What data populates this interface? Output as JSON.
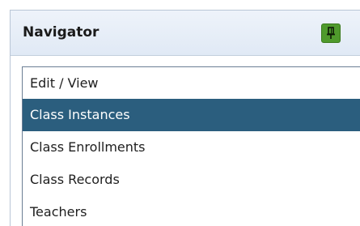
{
  "navigator": {
    "title": "Navigator",
    "pin_icon": "pin-icon",
    "accent_color": "#4f9a2c",
    "selected_color": "#2b5e7e",
    "items": [
      {
        "label": "Edit / View",
        "selected": false
      },
      {
        "label": "Class Instances",
        "selected": true
      },
      {
        "label": "Class Enrollments",
        "selected": false
      },
      {
        "label": "Class Records",
        "selected": false
      },
      {
        "label": "Teachers",
        "selected": false
      }
    ]
  }
}
